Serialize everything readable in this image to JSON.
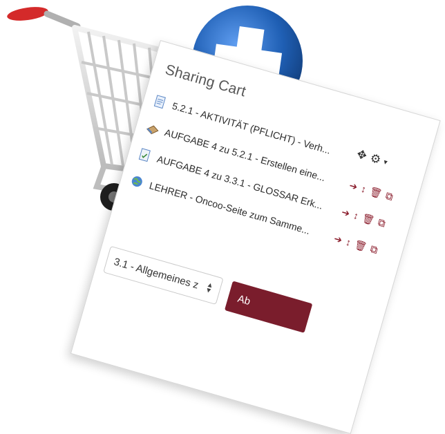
{
  "panel": {
    "title": "Sharing Cart",
    "controls": {
      "move": "✥",
      "settings": "⚙",
      "caret": "▼"
    }
  },
  "items": [
    {
      "icon": "page-icon",
      "label": "5.2.1 - AKTIVITÄT (PFLICHT) - Verh...",
      "actions": false
    },
    {
      "icon": "book-icon",
      "label": "AUFGABE 4 zu 5.2.1 - Erstellen eine...",
      "actions": true
    },
    {
      "icon": "assignment-icon",
      "label": "AUFGABE 4 zu 3.3.1 - GLOSSAR Erk...",
      "actions": true
    },
    {
      "icon": "globe-icon",
      "label": "LEHRER - Oncoo-Seite zum Samme...",
      "actions": true
    }
  ],
  "action_glyphs": {
    "restore": "➔",
    "move": "↕",
    "delete": "🗑",
    "copy": "⧉"
  },
  "section_select": {
    "value": "3.1 - Allgemeines z"
  },
  "submit": {
    "label": "Ab"
  },
  "colors": {
    "accent": "#7a1d2c",
    "cart_handle": "#d42a2a",
    "plus_badge": "#1f5fb4"
  }
}
